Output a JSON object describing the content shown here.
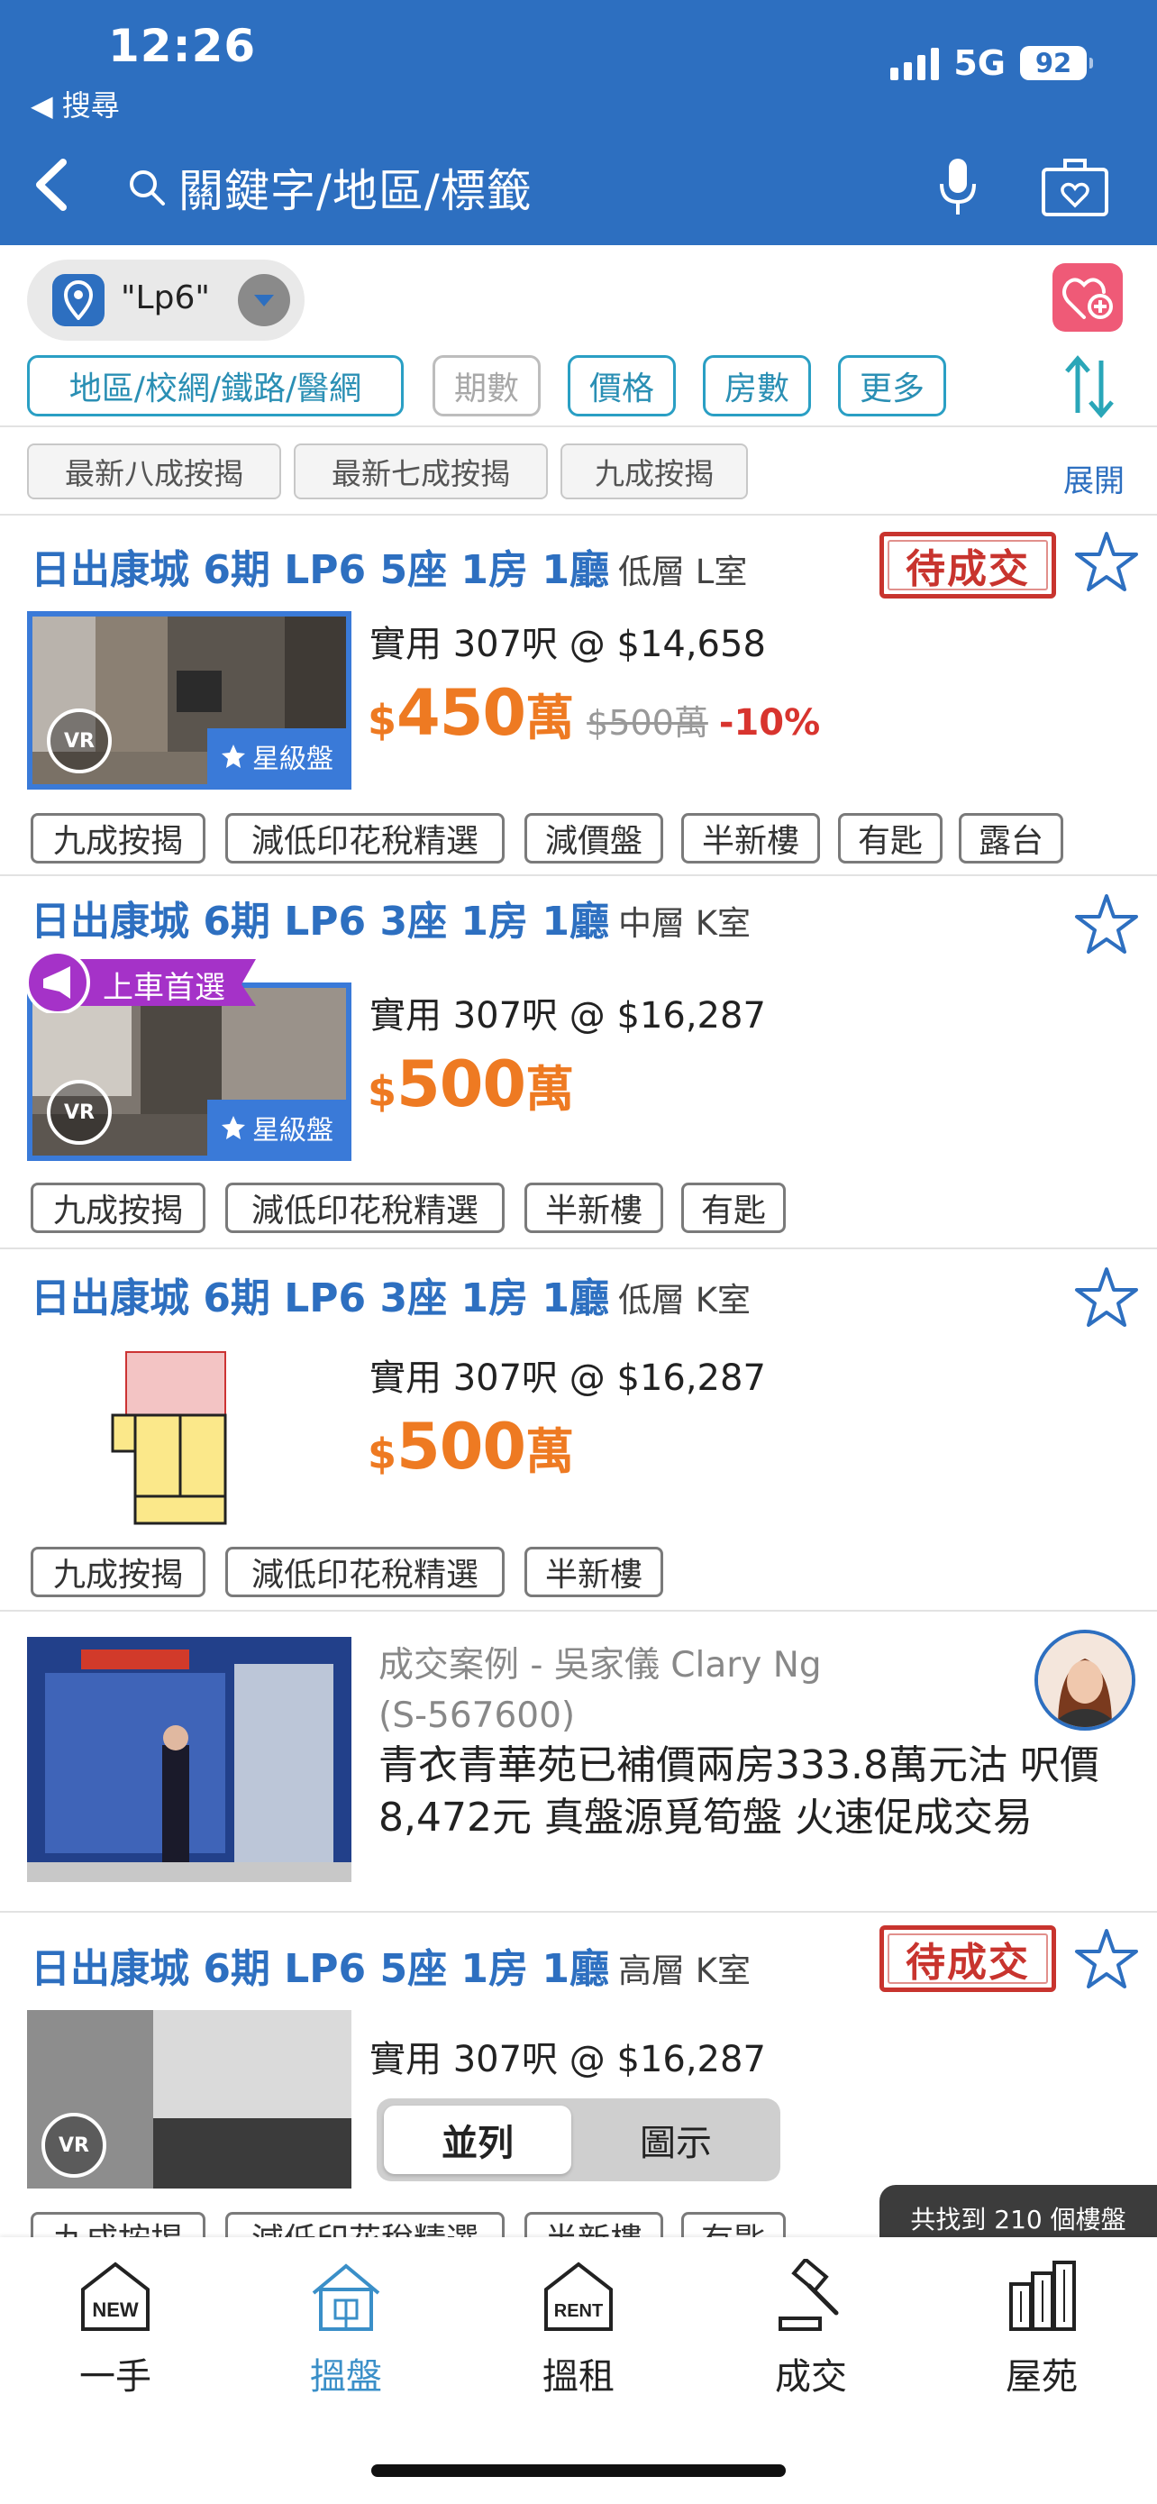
{
  "status_bar": {
    "time": "12:26",
    "back_app": "◀ 搜尋",
    "network": "5G",
    "battery": "92"
  },
  "header": {
    "search_placeholder": "關鍵字/地區/標籤"
  },
  "location": {
    "label": "\"Lp6\""
  },
  "filters": [
    {
      "label": "地區/校網/鐵路/醫網",
      "disabled": false
    },
    {
      "label": "期數",
      "disabled": true
    },
    {
      "label": "價格",
      "disabled": false
    },
    {
      "label": "房數",
      "disabled": false
    },
    {
      "label": "更多",
      "disabled": false
    }
  ],
  "quick_filters": [
    "最新八成按揭",
    "最新七成按揭",
    "九成按揭"
  ],
  "expand_label": "展開",
  "listings": [
    {
      "title": "日出康城 6期 LP6 5座 1房 1廳",
      "floor": "低層 L室",
      "pending": "待成交",
      "area": "實用 307呎 @ $14,658",
      "price_currency": "$",
      "price_amount": "450",
      "price_unit": "萬",
      "old_price": "$500萬",
      "discount": "-10%",
      "vr": "VR",
      "star_tag": "星級盤",
      "tags": [
        "九成按揭",
        "減低印花稅精選",
        "減價盤",
        "半新樓",
        "有匙",
        "露台"
      ]
    },
    {
      "title": "日出康城 6期 LP6 3座 1房 1廳",
      "floor": "中層 K室",
      "promo": "上車首選",
      "area": "實用 307呎 @ $16,287",
      "price_currency": "$",
      "price_amount": "500",
      "price_unit": "萬",
      "vr": "VR",
      "star_tag": "星級盤",
      "tags": [
        "九成按揭",
        "減低印花稅精選",
        "半新樓",
        "有匙"
      ]
    },
    {
      "title": "日出康城 6期 LP6 3座 1房 1廳",
      "floor": "低層 K室",
      "area": "實用 307呎 @ $16,287",
      "price_currency": "$",
      "price_amount": "500",
      "price_unit": "萬",
      "tags": [
        "九成按揭",
        "減低印花稅精選",
        "半新樓"
      ]
    },
    {
      "title": "日出康城 6期 LP6 5座 1房 1廳",
      "floor": "高層 K室",
      "pending": "待成交",
      "area": "實用 307呎 @ $16,287",
      "vr": "VR",
      "tags": [
        "九成按揭",
        "減低印花稅精選",
        "半新樓",
        "有匙"
      ]
    }
  ],
  "case_card": {
    "agent_line": "成交案例 - 吳家儀 Clary Ng",
    "license": "(S-567600)",
    "description": "青衣青華苑已補價兩房333.8萬元沽 呎價8,472元 真盤源覓筍盤 火速促成交易"
  },
  "view_toggle": {
    "list": "並列",
    "map": "圖示"
  },
  "result_count": "共找到 210 個樓盤",
  "bottom_nav": [
    {
      "label": "一手",
      "icon": "new-icon"
    },
    {
      "label": "搵盤",
      "icon": "house-icon"
    },
    {
      "label": "搵租",
      "icon": "rent-icon"
    },
    {
      "label": "成交",
      "icon": "gavel-icon"
    },
    {
      "label": "屋苑",
      "icon": "building-icon"
    }
  ],
  "colors": {
    "header_blue": "#2d6fc0",
    "price_orange": "#ee7a22",
    "pending_red": "#c8342e",
    "chip_teal": "#2a9fc4"
  }
}
